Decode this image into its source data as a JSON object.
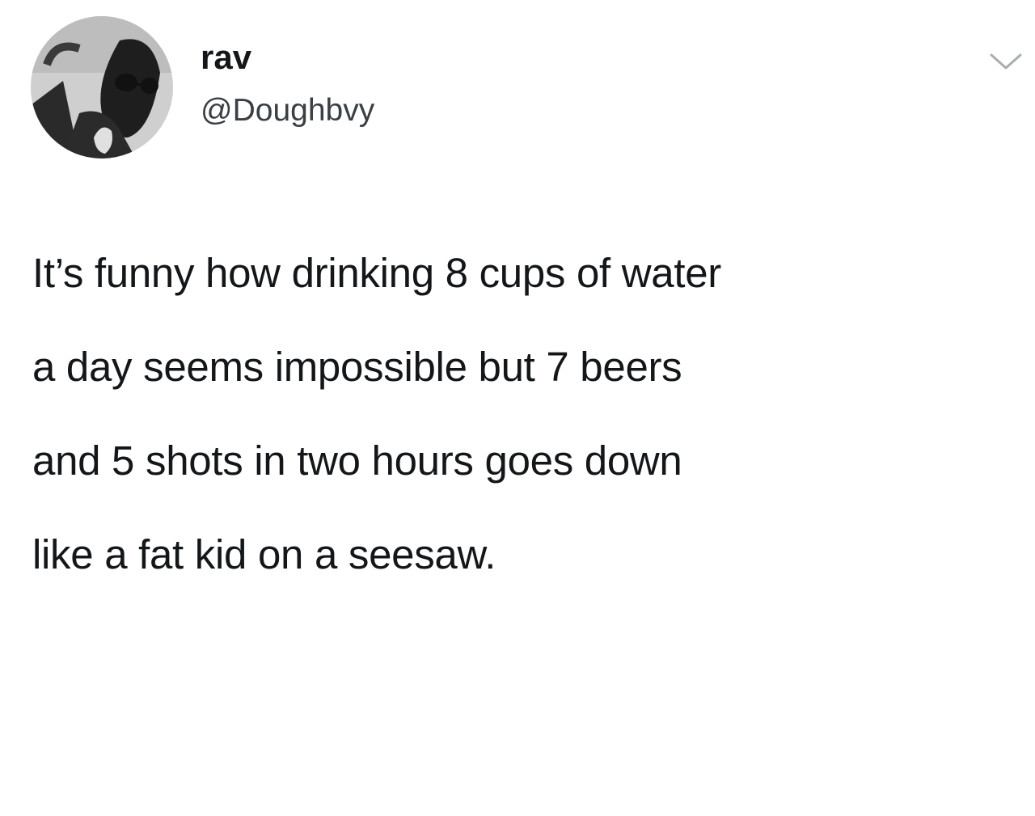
{
  "tweet": {
    "author": {
      "display_name": "rav",
      "handle": "@Doughbvy",
      "avatar_icon": "profile-photo"
    },
    "menu_icon": "chevron-down-icon",
    "text_lines": [
      "It’s funny how drinking 8 cups of water",
      "a day seems impossible but 7 beers",
      "and 5 shots in two hours goes down",
      "like a fat kid on a seesaw."
    ],
    "colors": {
      "background": "#ffffff",
      "text": "#14171a",
      "secondary_text": "#3a3f44",
      "chevron": "#a7adb3"
    }
  }
}
